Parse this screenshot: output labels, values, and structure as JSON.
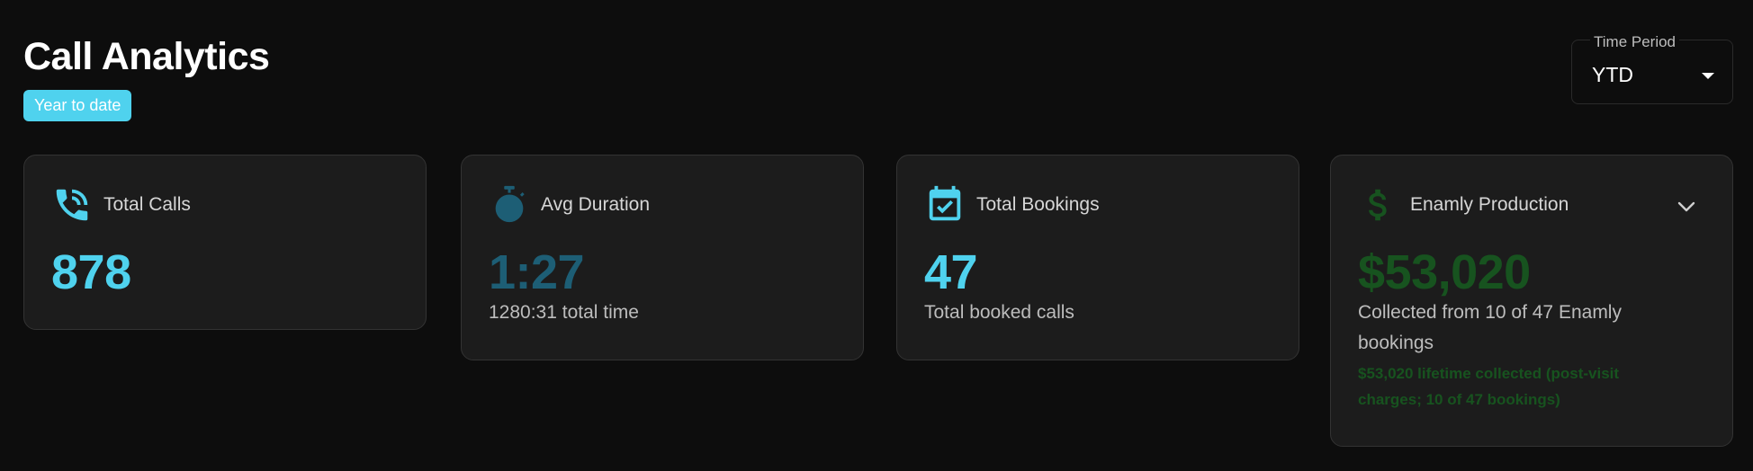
{
  "page": {
    "title": "Call Analytics",
    "badge": "Year to date"
  },
  "time_period": {
    "label": "Time Period",
    "value": "YTD"
  },
  "cards": [
    {
      "label": "Total Calls",
      "value": "878",
      "icon": "phone-icon",
      "value_color": "#4fd2ee"
    },
    {
      "label": "Avg Duration",
      "value": "1:27",
      "subtitle": "1280:31 total time",
      "icon": "stopwatch-icon",
      "value_color": "#1d5e75"
    },
    {
      "label": "Total Bookings",
      "value": "47",
      "subtitle": "Total booked calls",
      "icon": "calendar-check-icon",
      "value_color": "#4fd2ee"
    },
    {
      "label": "Enamly Production",
      "value": "$53,020",
      "subtitle_line1": "Collected from 10 of 47 Enamly",
      "subtitle_line2": "bookings",
      "note_line1": "$53,020 lifetime collected (post-visit",
      "note_line2": "charges; 10 of 47 bookings)",
      "icon": "dollar-icon",
      "value_color": "#17531f"
    }
  ],
  "colors": {
    "background": "#0d0d0d",
    "card": "#1c1c1c",
    "accent": "#4fd2ee",
    "accent_dark": "#1d5e75",
    "green": "#17531f"
  }
}
